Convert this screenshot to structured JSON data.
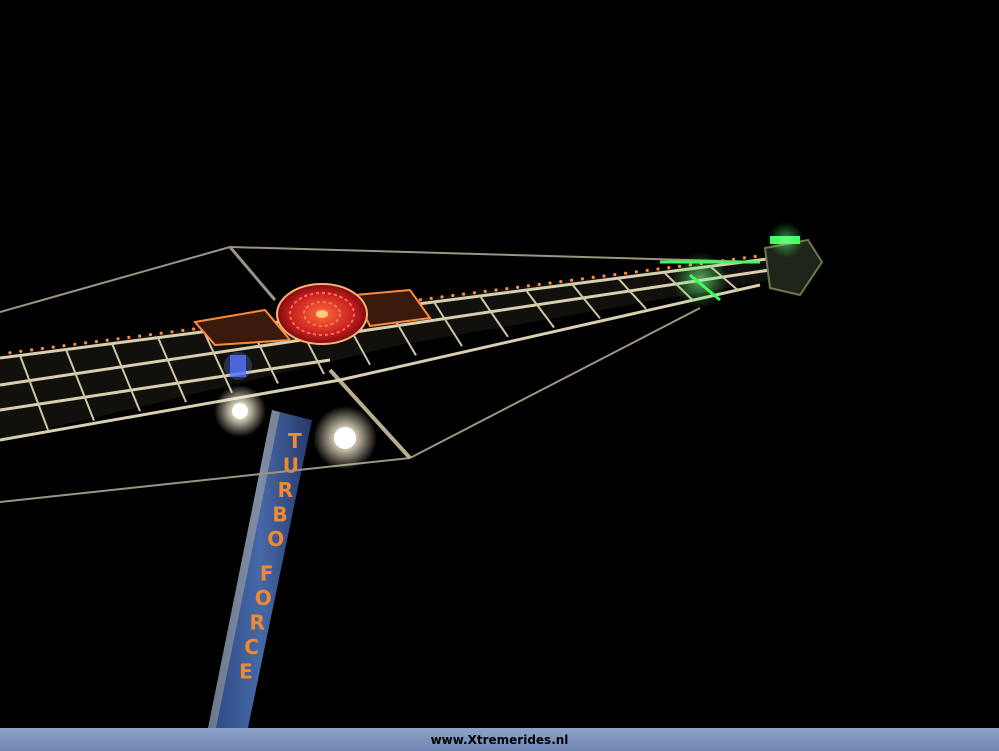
{
  "photo": {
    "subject": "",
    "tower_text": "TURBO FORCE",
    "colors": {
      "sky": "#000000",
      "truss": "#d8cfb0",
      "bulbs": "#ff8a3c",
      "wheel": "#d8282c",
      "green_lights": "#3dff5a",
      "tower": "#3a5a9a",
      "tower_letters": "#f08a30",
      "spotlight": "#fff4d8"
    }
  },
  "footer": {
    "watermark": "www.Xtremerides.nl"
  }
}
